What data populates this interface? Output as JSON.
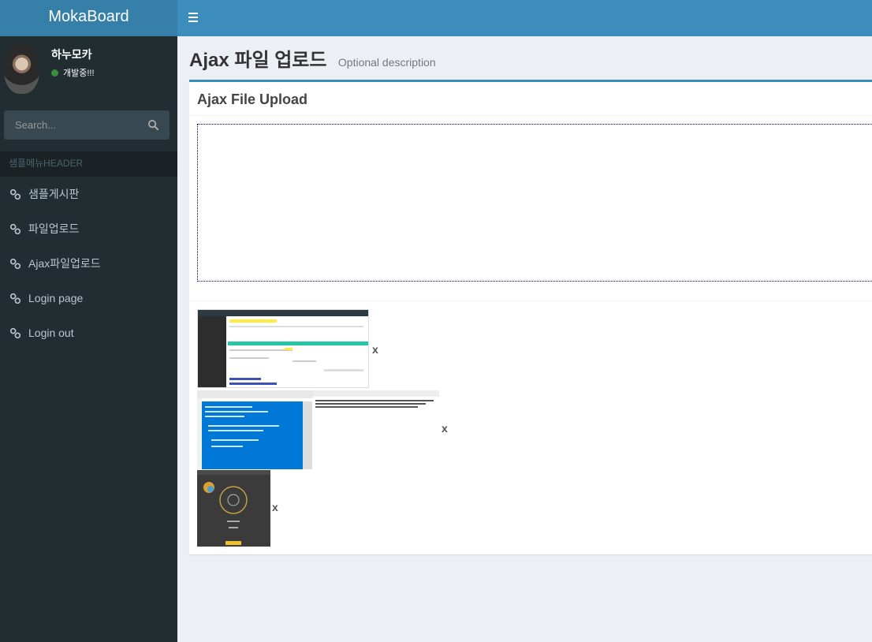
{
  "header": {
    "logo": "MokaBoard"
  },
  "user": {
    "name": "하누모카",
    "status": "개발중!!!",
    "status_color": "#3c8d3c"
  },
  "search": {
    "placeholder": "Search..."
  },
  "sidebar": {
    "header": "샘플메뉴HEADER",
    "items": [
      {
        "label": "샘플게시판",
        "icon": "link-icon"
      },
      {
        "label": "파일업로드",
        "icon": "link-icon"
      },
      {
        "label": "Ajax파일업로드",
        "icon": "link-icon"
      },
      {
        "label": "Login page",
        "icon": "link-icon"
      },
      {
        "label": "Login out",
        "icon": "link-icon"
      }
    ]
  },
  "page": {
    "title": "Ajax 파일 업로드",
    "description": "Optional description"
  },
  "box": {
    "title": "Ajax File Upload"
  },
  "uploads": [
    {
      "remove": "x"
    },
    {
      "remove": "x"
    },
    {
      "remove": "x"
    }
  ],
  "colors": {
    "accent": "#3c8dbc",
    "sidebar": "#222d32"
  }
}
